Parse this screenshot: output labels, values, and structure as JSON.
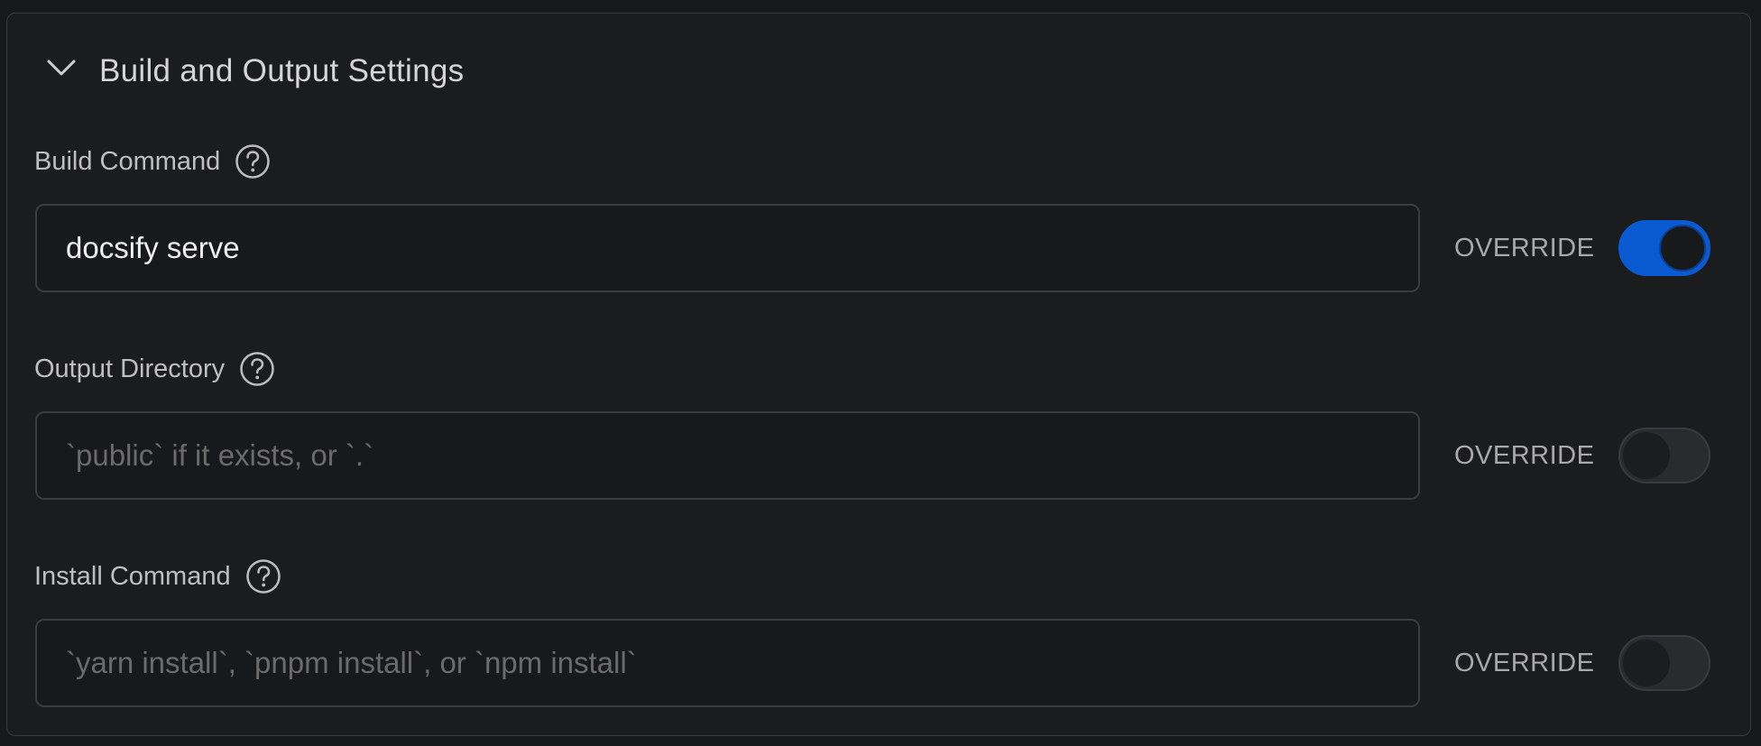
{
  "section": {
    "title": "Build and Output Settings",
    "icon": "chevron-down-icon",
    "expanded": true
  },
  "fields": [
    {
      "label": "Build Command",
      "help_icon": "question-circle-icon",
      "value": "docsify serve",
      "placeholder": "",
      "override_label": "OVERRIDE",
      "override_enabled": true
    },
    {
      "label": "Output Directory",
      "help_icon": "question-circle-icon",
      "value": "",
      "placeholder": "`public` if it exists, or `.`",
      "override_label": "OVERRIDE",
      "override_enabled": false
    },
    {
      "label": "Install Command",
      "help_icon": "question-circle-icon",
      "value": "",
      "placeholder": "`yarn install`, `pnpm install`, or `npm install`",
      "override_label": "OVERRIDE",
      "override_enabled": false
    }
  ],
  "colors": {
    "background": "#18191b",
    "panel": "#1b1c1e",
    "border": "#3a3b3e",
    "toggle_on": "#0a5bd1",
    "text": "#d6d6d6",
    "placeholder": "#6b6b6b"
  }
}
